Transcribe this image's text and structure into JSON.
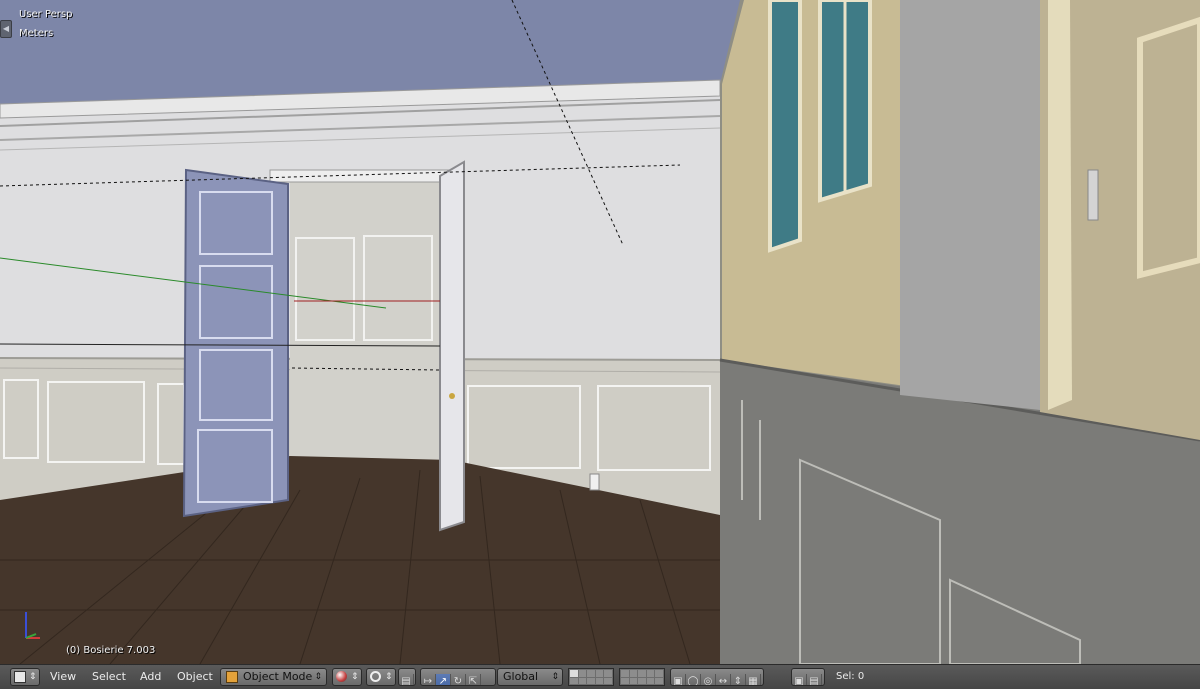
{
  "viewport": {
    "view_label": "User Persp",
    "units_label": "Meters",
    "object_info": "(0) Bosierie 7.003",
    "collapse_left_icon": "triangle-left-icon",
    "axis_icon": "axis-gizmo-icon"
  },
  "colors": {
    "sky": "#7d86a8",
    "wall": "#dcdcdc",
    "wainscot": "#cfcdc4",
    "door": "#8b93b7",
    "floor": "#43352a",
    "header_bg": "#4f4f4f",
    "active_button": "#4566a3"
  },
  "header": {
    "editor_type_icon": "cube-icon",
    "menus": [
      "View",
      "Select",
      "Add",
      "Object"
    ],
    "mode": "Object Mode",
    "shading_icon": "sphere-shading-icon",
    "pivot_icon": "pivot-point-icon",
    "transform_orientation": "Global",
    "sel_label": "Sel: 0"
  }
}
